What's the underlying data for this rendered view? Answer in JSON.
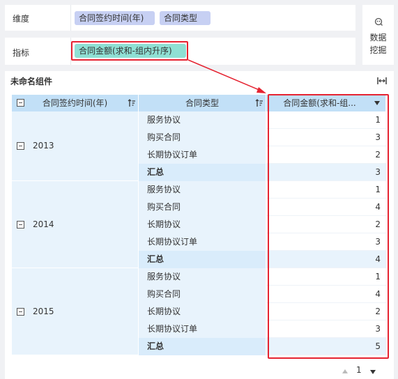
{
  "dimension": {
    "label": "维度",
    "pills": [
      "合同签约时间(年)",
      "合同类型"
    ]
  },
  "metric": {
    "label": "指标",
    "pill": "合同金额(求和-组内升序)"
  },
  "mining": {
    "label": "数据挖掘"
  },
  "component": {
    "title": "未命名组件"
  },
  "table": {
    "headers": {
      "year": "合同签约时间(年)",
      "type": "合同类型",
      "amount": "合同金额(求和-组..."
    },
    "groups": [
      {
        "year": "2013",
        "rows": [
          {
            "type": "服务协议",
            "amount": "1"
          },
          {
            "type": "购买合同",
            "amount": "3"
          },
          {
            "type": "长期协议订单",
            "amount": "2"
          },
          {
            "type": "汇总",
            "amount": "3"
          }
        ]
      },
      {
        "year": "2014",
        "rows": [
          {
            "type": "服务协议",
            "amount": "1"
          },
          {
            "type": "购买合同",
            "amount": "4"
          },
          {
            "type": "长期协议",
            "amount": "2"
          },
          {
            "type": "长期协议订单",
            "amount": "3"
          },
          {
            "type": "汇总",
            "amount": "4"
          }
        ]
      },
      {
        "year": "2015",
        "rows": [
          {
            "type": "服务协议",
            "amount": "1"
          },
          {
            "type": "购买合同",
            "amount": "4"
          },
          {
            "type": "长期协议",
            "amount": "2"
          },
          {
            "type": "长期协议订单",
            "amount": "3"
          },
          {
            "type": "汇总",
            "amount": "5"
          }
        ]
      }
    ]
  },
  "pager": {
    "page": "1"
  },
  "colors": {
    "header_bg": "#c2e0f7",
    "cell_bg": "#e8f3fc",
    "highlight": "#e52331",
    "dim_pill": "#c7d0f3",
    "metric_pill": "#8fe0d4"
  }
}
